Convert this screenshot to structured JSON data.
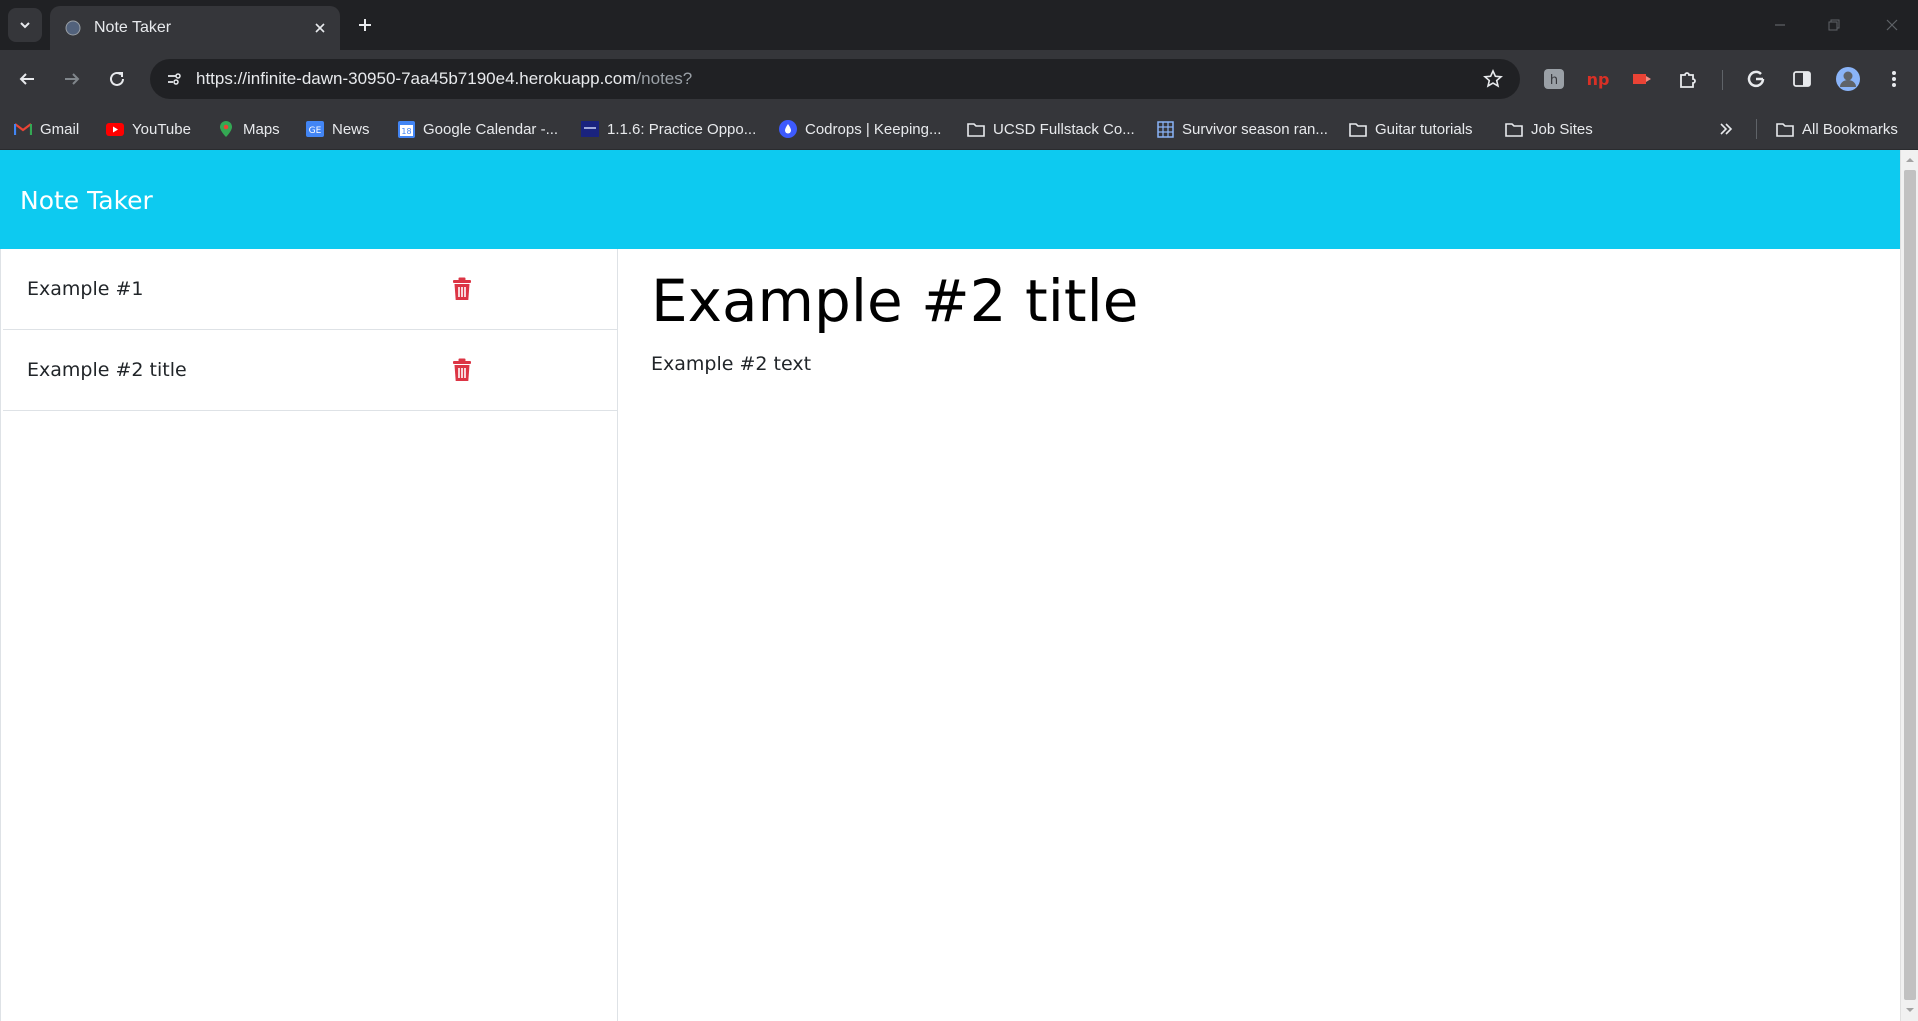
{
  "browser": {
    "tab_title": "Note Taker",
    "url_host": "https://infinite-dawn-30950-7aa45b7190e4.herokuapp.com",
    "url_path": "/notes?",
    "bookmarks": [
      {
        "label": "Gmail",
        "icon": "gmail-icon"
      },
      {
        "label": "YouTube",
        "icon": "youtube-icon"
      },
      {
        "label": "Maps",
        "icon": "maps-icon"
      },
      {
        "label": "News",
        "icon": "news-icon"
      },
      {
        "label": "Google Calendar -...",
        "icon": "calendar-icon"
      },
      {
        "label": "1.1.6: Practice Oppo...",
        "icon": "course-icon"
      },
      {
        "label": "Codrops | Keeping...",
        "icon": "codrops-icon"
      },
      {
        "label": "UCSD Fullstack Co...",
        "icon": "folder-icon"
      },
      {
        "label": "Survivor season ran...",
        "icon": "sheets-icon"
      },
      {
        "label": "Guitar tutorials",
        "icon": "folder-icon"
      },
      {
        "label": "Job Sites",
        "icon": "folder-icon"
      }
    ],
    "all_bookmarks_label": "All Bookmarks"
  },
  "app": {
    "brand": "Note Taker",
    "notes": [
      {
        "title": "Example #1"
      },
      {
        "title": "Example #2 title"
      }
    ],
    "active_note": {
      "title": "Example #2 title",
      "text": "Example #2 text"
    }
  },
  "colors": {
    "navbar": "#0dcaf0",
    "trash": "#dc3545",
    "chrome_dark": "#202124",
    "chrome_toolbar": "#35363a"
  }
}
